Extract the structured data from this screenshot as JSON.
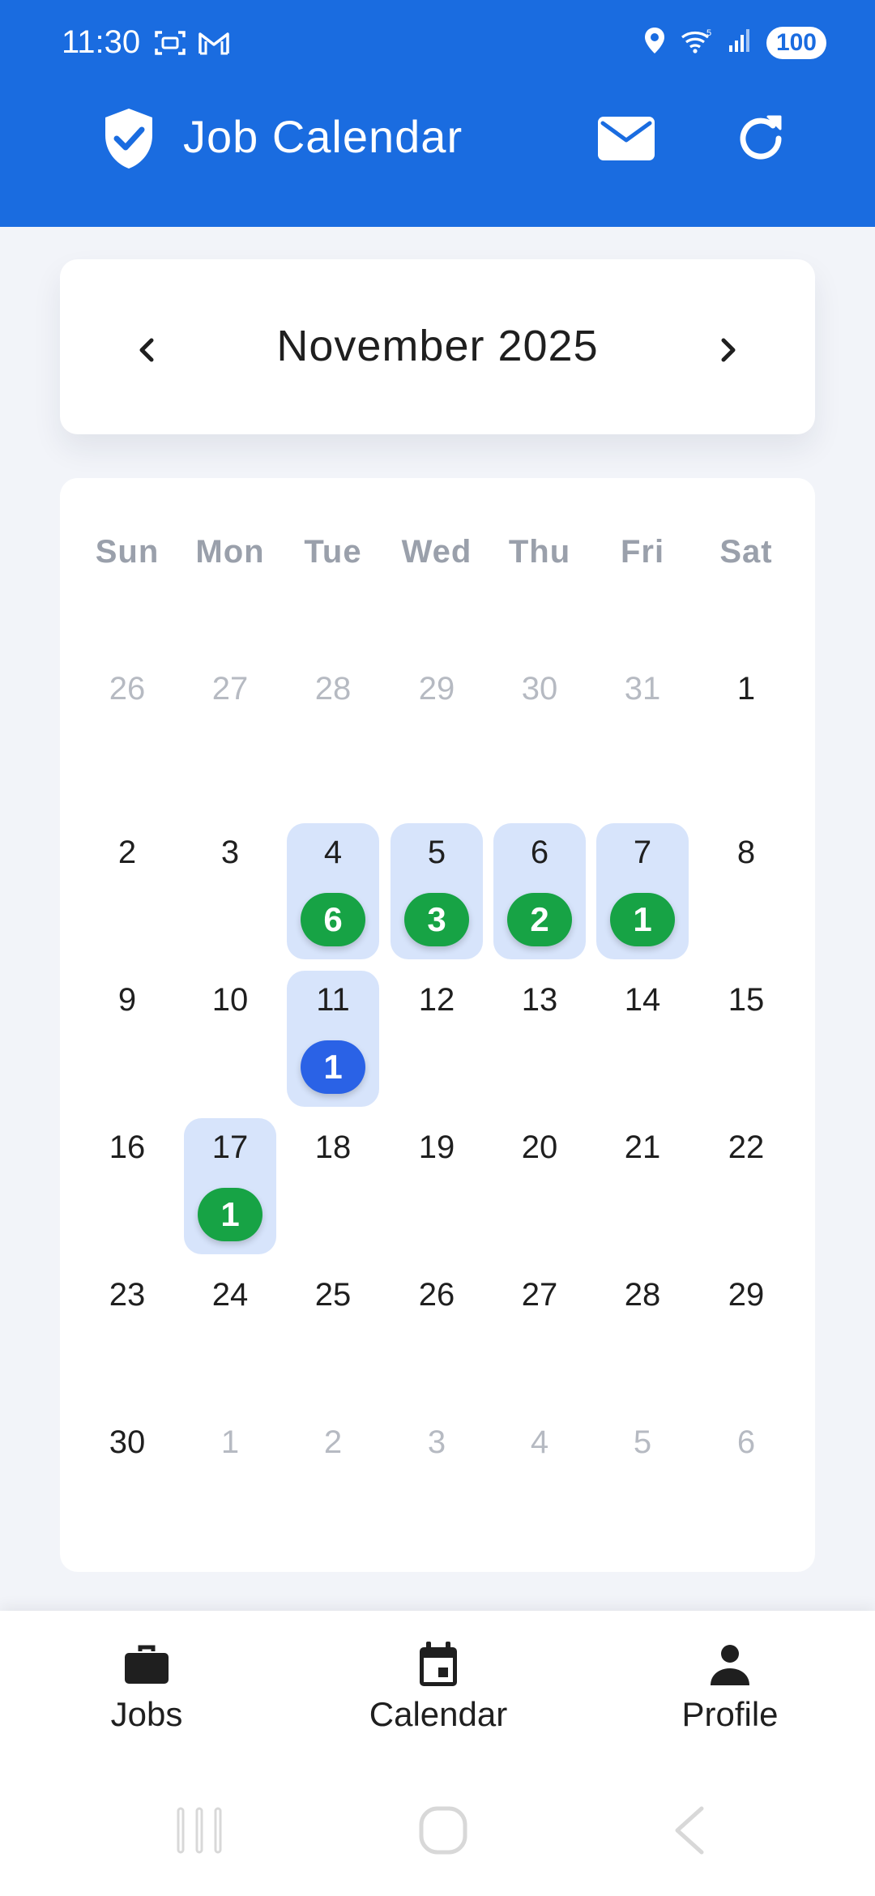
{
  "status_bar": {
    "time": "11:30",
    "battery": "100",
    "left_icons": [
      "screenshot-icon",
      "gmail-icon"
    ],
    "right_icons": [
      "location-icon",
      "wifi-icon",
      "signal-icon"
    ]
  },
  "app_bar": {
    "title": "Job Calendar",
    "background_color": "#1a6ce0",
    "icons": [
      "shield-check-icon",
      "mail-icon",
      "refresh-icon"
    ]
  },
  "month_nav": {
    "title": "November 2025",
    "prev_icon": "chevron-left-icon",
    "next_icon": "chevron-right-icon"
  },
  "weekdays": [
    "Sun",
    "Mon",
    "Tue",
    "Wed",
    "Thu",
    "Fri",
    "Sat"
  ],
  "calendar": {
    "weeks": [
      [
        {
          "d": "26",
          "muted": true
        },
        {
          "d": "27",
          "muted": true
        },
        {
          "d": "28",
          "muted": true
        },
        {
          "d": "29",
          "muted": true
        },
        {
          "d": "30",
          "muted": true
        },
        {
          "d": "31",
          "muted": true
        },
        {
          "d": "1"
        }
      ],
      [
        {
          "d": "2"
        },
        {
          "d": "3"
        },
        {
          "d": "4",
          "jobs": "6",
          "color": "green"
        },
        {
          "d": "5",
          "jobs": "3",
          "color": "green"
        },
        {
          "d": "6",
          "jobs": "2",
          "color": "green"
        },
        {
          "d": "7",
          "jobs": "1",
          "color": "green"
        },
        {
          "d": "8"
        }
      ],
      [
        {
          "d": "9"
        },
        {
          "d": "10"
        },
        {
          "d": "11",
          "jobs": "1",
          "color": "blue"
        },
        {
          "d": "12"
        },
        {
          "d": "13"
        },
        {
          "d": "14"
        },
        {
          "d": "15"
        }
      ],
      [
        {
          "d": "16"
        },
        {
          "d": "17",
          "jobs": "1",
          "color": "green"
        },
        {
          "d": "18"
        },
        {
          "d": "19"
        },
        {
          "d": "20"
        },
        {
          "d": "21"
        },
        {
          "d": "22"
        }
      ],
      [
        {
          "d": "23"
        },
        {
          "d": "24"
        },
        {
          "d": "25"
        },
        {
          "d": "26"
        },
        {
          "d": "27"
        },
        {
          "d": "28"
        },
        {
          "d": "29"
        }
      ],
      [
        {
          "d": "30"
        },
        {
          "d": "1",
          "muted": true
        },
        {
          "d": "2",
          "muted": true
        },
        {
          "d": "3",
          "muted": true
        },
        {
          "d": "4",
          "muted": true
        },
        {
          "d": "5",
          "muted": true
        },
        {
          "d": "6",
          "muted": true
        }
      ]
    ],
    "badge_colors": {
      "green": "#17a345",
      "blue": "#2a62e6"
    },
    "highlight_color": "#d7e4fb"
  },
  "bottom_nav": {
    "items": [
      {
        "label": "Jobs",
        "icon": "briefcase-icon"
      },
      {
        "label": "Calendar",
        "icon": "calendar-icon"
      },
      {
        "label": "Profile",
        "icon": "person-icon"
      }
    ]
  },
  "system_nav": {
    "icons": [
      "recents-icon",
      "home-icon",
      "back-icon"
    ]
  }
}
